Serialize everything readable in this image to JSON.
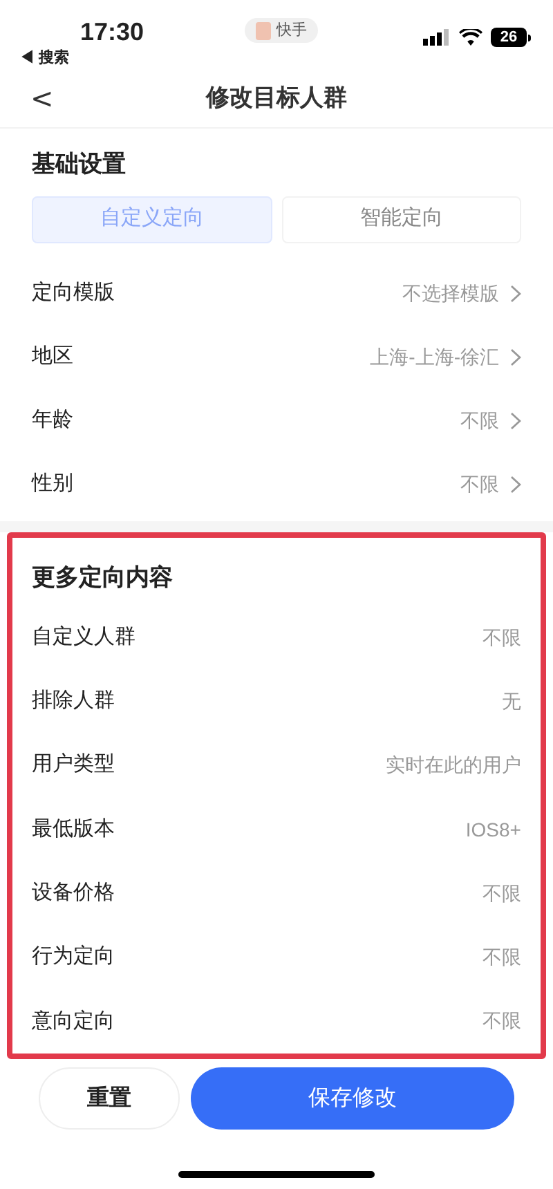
{
  "status_bar": {
    "time": "17:30",
    "back_app": "◀ 搜索",
    "app_pill": "快手",
    "battery": "26"
  },
  "nav": {
    "back": "<",
    "title": "修改目标人群"
  },
  "basic": {
    "title": "基础设置",
    "tabs": [
      {
        "label": "自定义定向",
        "selected": true
      },
      {
        "label": "智能定向",
        "selected": false
      }
    ],
    "rows": [
      {
        "label": "定向模版",
        "value": "不选择模版"
      },
      {
        "label": "地区",
        "value": "上海-上海-徐汇"
      },
      {
        "label": "年龄",
        "value": "不限"
      },
      {
        "label": "性别",
        "value": "不限"
      }
    ]
  },
  "more": {
    "title": "更多定向内容",
    "highlighted": true,
    "rows": [
      {
        "label": "自定义人群",
        "value": "不限"
      },
      {
        "label": "排除人群",
        "value": "无"
      },
      {
        "label": "用户类型",
        "value": "实时在此的用户"
      },
      {
        "label": "最低版本",
        "value": "IOS8+"
      },
      {
        "label": "设备价格",
        "value": "不限"
      },
      {
        "label": "行为定向",
        "value": "不限"
      },
      {
        "label": "意向定向",
        "value": "不限"
      }
    ]
  },
  "buttons": {
    "reset": "重置",
    "save": "保存修改"
  }
}
